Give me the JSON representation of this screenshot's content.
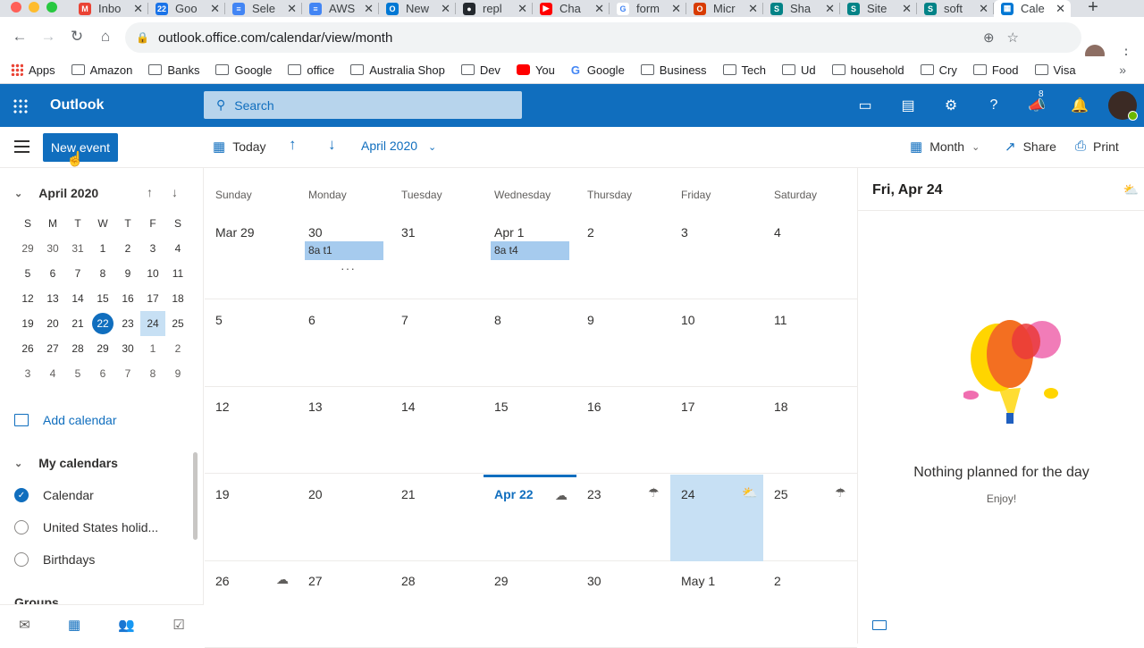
{
  "browser": {
    "tabs": [
      {
        "label": "Inbo",
        "color": "#ea4335",
        "glyph": "M"
      },
      {
        "label": "Goo",
        "color": "#1a73e8",
        "glyph": "22"
      },
      {
        "label": "Sele",
        "color": "#4285f4",
        "glyph": "≡"
      },
      {
        "label": "AWS",
        "color": "#4285f4",
        "glyph": "≡"
      },
      {
        "label": "New",
        "color": "#0078d4",
        "glyph": "O"
      },
      {
        "label": "repl",
        "color": "#24292e",
        "glyph": "●"
      },
      {
        "label": "Cha",
        "color": "#ff0000",
        "glyph": "▶"
      },
      {
        "label": "form",
        "color": "#ffffff",
        "glyph": "G"
      },
      {
        "label": "Micr",
        "color": "#d83b01",
        "glyph": "O"
      },
      {
        "label": "Sha",
        "color": "#038387",
        "glyph": "S"
      },
      {
        "label": "Site",
        "color": "#038387",
        "glyph": "S"
      },
      {
        "label": "soft",
        "color": "#038387",
        "glyph": "S"
      },
      {
        "label": "Cale",
        "color": "#0078d4",
        "glyph": "▦",
        "active": true
      }
    ],
    "url": "outlook.office.com/calendar/view/month",
    "bookmarks": [
      {
        "label": "Apps",
        "icon": "apps"
      },
      {
        "label": "Amazon",
        "icon": "folder"
      },
      {
        "label": "Banks",
        "icon": "folder"
      },
      {
        "label": "Google",
        "icon": "folder"
      },
      {
        "label": "office",
        "icon": "folder"
      },
      {
        "label": "Australia Shop",
        "icon": "folder"
      },
      {
        "label": "Dev",
        "icon": "folder"
      },
      {
        "label": "You",
        "icon": "youtube"
      },
      {
        "label": "Google",
        "icon": "google"
      },
      {
        "label": "Business",
        "icon": "folder"
      },
      {
        "label": "Tech",
        "icon": "folder"
      },
      {
        "label": "Ud",
        "icon": "folder"
      },
      {
        "label": "household",
        "icon": "folder"
      },
      {
        "label": "Cry",
        "icon": "folder"
      },
      {
        "label": "Food",
        "icon": "folder"
      },
      {
        "label": "Visa",
        "icon": "folder"
      }
    ]
  },
  "header": {
    "app_title": "Outlook",
    "search_placeholder": "Search",
    "notification_count": "8",
    "accent": "#106ebe"
  },
  "commandbar": {
    "new_event": "New event",
    "today": "Today",
    "month_label": "April 2020",
    "view": "Month",
    "share": "Share",
    "print": "Print"
  },
  "minical": {
    "title": "April 2020",
    "dow": [
      "S",
      "M",
      "T",
      "W",
      "T",
      "F",
      "S"
    ],
    "weeks": [
      [
        "29",
        "30",
        "31",
        "1",
        "2",
        "3",
        "4"
      ],
      [
        "5",
        "6",
        "7",
        "8",
        "9",
        "10",
        "11"
      ],
      [
        "12",
        "13",
        "14",
        "15",
        "16",
        "17",
        "18"
      ],
      [
        "19",
        "20",
        "21",
        "22",
        "23",
        "24",
        "25"
      ],
      [
        "26",
        "27",
        "28",
        "29",
        "30",
        "1",
        "2"
      ],
      [
        "3",
        "4",
        "5",
        "6",
        "7",
        "8",
        "9"
      ]
    ],
    "today": "22",
    "selected": "24"
  },
  "sidebar": {
    "add_calendar": "Add calendar",
    "my_calendars": "My calendars",
    "calendars": [
      {
        "label": "Calendar",
        "checked": true
      },
      {
        "label": "United States holid...",
        "checked": false
      },
      {
        "label": "Birthdays",
        "checked": false
      }
    ],
    "groups": "Groups"
  },
  "month": {
    "dow": [
      "Sunday",
      "Monday",
      "Tuesday",
      "Wednesday",
      "Thursday",
      "Friday",
      "Saturday"
    ],
    "weeks": [
      [
        {
          "n": "Mar 29"
        },
        {
          "n": "30",
          "event": "8a t1",
          "more": "···"
        },
        {
          "n": "31"
        },
        {
          "n": "Apr 1",
          "event": "8a t4"
        },
        {
          "n": "2"
        },
        {
          "n": "3"
        },
        {
          "n": "4"
        }
      ],
      [
        {
          "n": "5"
        },
        {
          "n": "6"
        },
        {
          "n": "7"
        },
        {
          "n": "8"
        },
        {
          "n": "9"
        },
        {
          "n": "10"
        },
        {
          "n": "11"
        }
      ],
      [
        {
          "n": "12"
        },
        {
          "n": "13"
        },
        {
          "n": "14"
        },
        {
          "n": "15"
        },
        {
          "n": "16"
        },
        {
          "n": "17"
        },
        {
          "n": "18"
        }
      ],
      [
        {
          "n": "19"
        },
        {
          "n": "20"
        },
        {
          "n": "21"
        },
        {
          "n": "Apr 22",
          "today": true,
          "wx": "☁"
        },
        {
          "n": "23",
          "wx": "☂"
        },
        {
          "n": "24",
          "selected": true,
          "wx": "⛅"
        },
        {
          "n": "25",
          "wx": "☂"
        }
      ],
      [
        {
          "n": "26",
          "wx": "☁"
        },
        {
          "n": "27"
        },
        {
          "n": "28"
        },
        {
          "n": "29"
        },
        {
          "n": "30"
        },
        {
          "n": "May 1"
        },
        {
          "n": "2"
        }
      ]
    ]
  },
  "agenda": {
    "date": "Fri, Apr 24",
    "empty_title": "Nothing planned for the day",
    "empty_subtitle": "Enjoy!"
  }
}
